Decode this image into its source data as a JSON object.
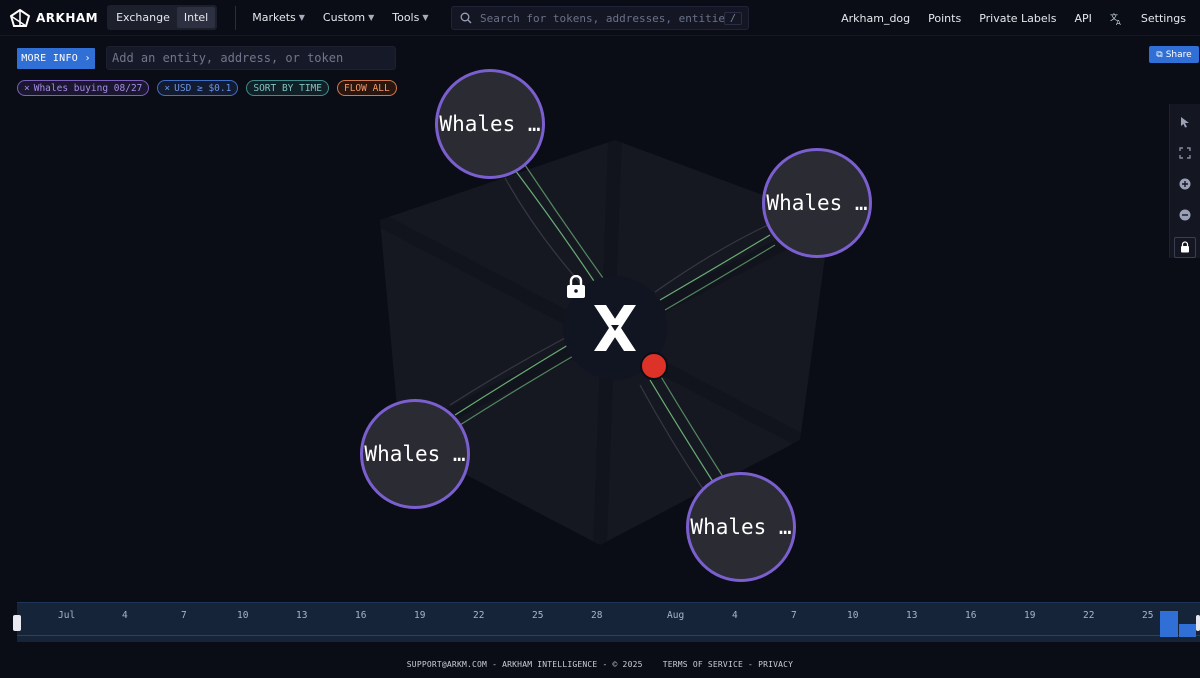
{
  "header": {
    "logo_text": "ARKHAM",
    "segments": [
      "Exchange",
      "Intel"
    ],
    "active_segment": "Intel",
    "menu": [
      {
        "label": "Markets"
      },
      {
        "label": "Custom"
      },
      {
        "label": "Tools"
      }
    ],
    "search_placeholder": "Search for tokens, addresses, entities...",
    "search_shortcut": "/",
    "right": [
      "Arkham_dog",
      "Points",
      "Private Labels",
      "API",
      "Settings"
    ]
  },
  "toolbar": {
    "more_info_label": "MORE INFO",
    "add_entity_placeholder": "Add an entity, address, or token",
    "share_label": "Share"
  },
  "filters": [
    {
      "label": "Whales buying 08/27",
      "removable": true,
      "color": "#a58be6"
    },
    {
      "label": "USD ≥ $0.1",
      "removable": true,
      "color": "#6c95e8"
    },
    {
      "label": "SORT BY TIME",
      "removable": false,
      "color": "#7ec3c3"
    },
    {
      "label": "FLOW ALL",
      "removable": false,
      "color": "#f29a6b"
    }
  ],
  "graph": {
    "center_node": {
      "icon": "x-logo-icon",
      "locked": true,
      "status_color": "#dc3228"
    },
    "nodes": [
      {
        "label": "Whales …"
      },
      {
        "label": "Whales …"
      },
      {
        "label": "Whales …"
      },
      {
        "label": "Whales …"
      }
    ],
    "edge_color": "#7ed38a",
    "node_border_color": "#7b5fcf"
  },
  "side_tools": [
    "pointer-icon",
    "fit-screen-icon",
    "zoom-in-icon",
    "zoom-out-icon",
    "lock-icon"
  ],
  "timeline": {
    "ticks": [
      "Jul",
      "4",
      "7",
      "10",
      "13",
      "16",
      "19",
      "22",
      "25",
      "28",
      "Aug",
      "4",
      "7",
      "10",
      "13",
      "16",
      "19",
      "22",
      "25"
    ]
  },
  "footer": {
    "email": "SUPPORT@ARKM.COM",
    "company": "ARKHAM INTELLIGENCE",
    "copyright": "© 2025",
    "terms": "TERMS OF SERVICE",
    "privacy": "PRIVACY"
  }
}
